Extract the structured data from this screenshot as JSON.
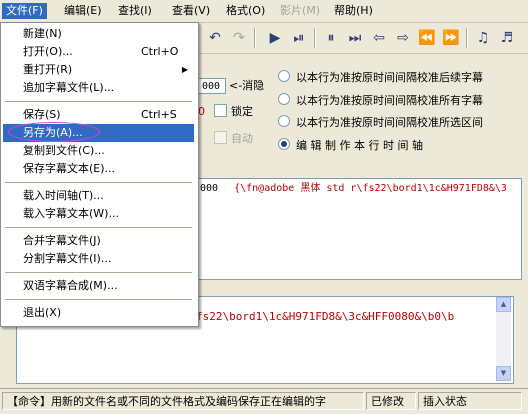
{
  "menubar": {
    "items": [
      "文件(F)",
      "编辑(E)",
      "查找(I)",
      "查看(V)",
      "格式(O)",
      "影片(M)",
      "帮助(H)"
    ]
  },
  "panel": {
    "timefield": "000",
    "dismiss_label": "<-消隐",
    "red_value": "0",
    "lock_label": "锁定",
    "auto_label": "自动",
    "radio1": "以本行为准按原时间间隔校准后续字幕",
    "radio2": "以本行为准按原时间间隔校准所有字幕",
    "radio3": "以本行为准按原时间间隔校准所选区间",
    "radio4": "编 辑 制 作 本 行 时 间 轴"
  },
  "list": {
    "time": "000",
    "text": "{\\fn@adobe 黑体 std r\\fs22\\bord1\\1c&H971FD8&\\3"
  },
  "editor": {
    "text": "fs22\\bord1\\1c&H971FD8&\\3c&HFF0080&\\b0\\b"
  },
  "status": {
    "message": "【命令】用新的文件名或不同的文件格式及编码保存正在编辑的字",
    "modified": "已修改",
    "mode": "插入状态"
  },
  "file_menu": {
    "new": "新建(N)",
    "open": "打开(O)...",
    "open_shortcut": "Ctrl+O",
    "reopen": "重打开(R)",
    "append": "追加字幕文件(L)...",
    "save": "保存(S)",
    "save_shortcut": "Ctrl+S",
    "save_as": "另存为(A)...",
    "copy_to": "复制到文件(C)...",
    "save_text": "保存字幕文本(E)...",
    "load_timeline": "载入时间轴(T)...",
    "load_text": "载入字幕文本(W)...",
    "merge": "合并字幕文件(J)",
    "split": "分割字幕文件(I)...",
    "bilingual": "双语字幕合成(M)...",
    "exit": "退出(X)"
  },
  "colors": {
    "highlight": "#316ac5",
    "ring": "#e040e0",
    "red_text": "#c00000"
  }
}
